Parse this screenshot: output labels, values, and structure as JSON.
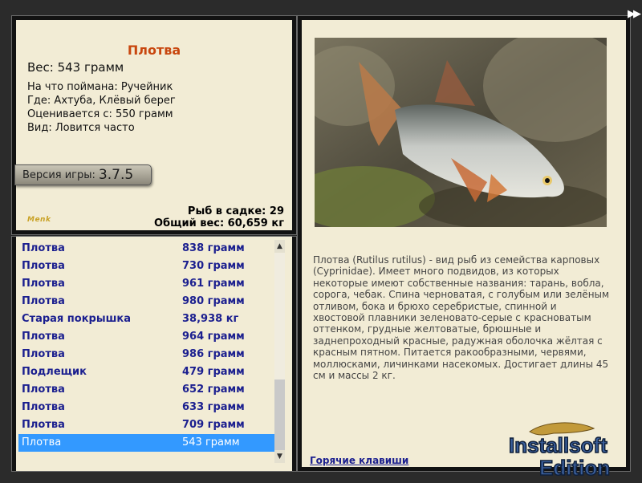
{
  "fish": {
    "title": "Плотва",
    "weight": "Вес: 543 грамм",
    "bait": "На что поймана: Ручейник",
    "location": "Где: Ахтуба, Клёвый берег",
    "rated": "Оценивается с: 550 грамм",
    "type": "Вид: Ловится часто"
  },
  "version": {
    "label": "Версия игры:",
    "value": "3.7.5"
  },
  "logo_text": "Menk",
  "stats": {
    "count": "Рыб в садке: 29",
    "total": "Общий вес: 60,659 кг"
  },
  "catch_list": [
    {
      "name": "Плотва",
      "weight": "838 грамм"
    },
    {
      "name": "Плотва",
      "weight": "730 грамм"
    },
    {
      "name": "Плотва",
      "weight": "961 грамм"
    },
    {
      "name": "Плотва",
      "weight": "980 грамм"
    },
    {
      "name": "Старая покрышка",
      "weight": "38,938 кг"
    },
    {
      "name": "Плотва",
      "weight": "964 грамм"
    },
    {
      "name": "Плотва",
      "weight": "986 грамм"
    },
    {
      "name": "Подлещик",
      "weight": "479 грамм"
    },
    {
      "name": "Плотва",
      "weight": "652 грамм"
    },
    {
      "name": "Плотва",
      "weight": "633 грамм"
    },
    {
      "name": "Плотва",
      "weight": "709 грамм"
    },
    {
      "name": "Плотва",
      "weight": "543 грамм"
    }
  ],
  "description": "Плотва (Rutilus rutilus) - вид рыб из семейства карповых (Cyprinidae). Имеет много подвидов, из которых некоторые имеют собственные названия: тарань, вобла, сорога, чебак. Спина черноватая, с голубым или зелёным отливом, бока и брюхо серебристые, спинной и хвостовой плавники зеленовато-серые с красноватым оттенком, грудные желтоватые, брюшные и заднепроходный красные, радужная оболочка жёлтая с красным пятном. Питается ракообразными, червями, моллюсками, личинками насекомых. Достигает длины 45 см и массы 2 кг.",
  "hotkeys": "Горячие клавиши",
  "icons": {
    "next": "double-arrow-right-icon",
    "scroll_up": "arrow-up-icon",
    "scroll_down": "arrow-down-icon"
  },
  "brand": {
    "line1": "Installsoft",
    "line2": "Edition"
  },
  "colors": {
    "title": "#c8460e",
    "list_text": "#1b1f8f",
    "selected": "#3399ff",
    "panel": "#f2ecd5"
  }
}
